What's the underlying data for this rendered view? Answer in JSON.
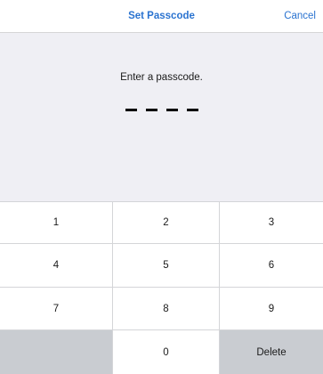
{
  "navbar": {
    "title": "Set Passcode",
    "cancel_label": "Cancel"
  },
  "prompt": {
    "text": "Enter a passcode."
  },
  "passcode": {
    "length": 4,
    "entered": 0
  },
  "keypad": {
    "keys": [
      "1",
      "2",
      "3",
      "4",
      "5",
      "6",
      "7",
      "8",
      "9",
      "",
      "0",
      "Delete"
    ]
  },
  "colors": {
    "accent": "#2a73d0",
    "background": "#efeff4",
    "key_dark": "#c9ccd1"
  }
}
